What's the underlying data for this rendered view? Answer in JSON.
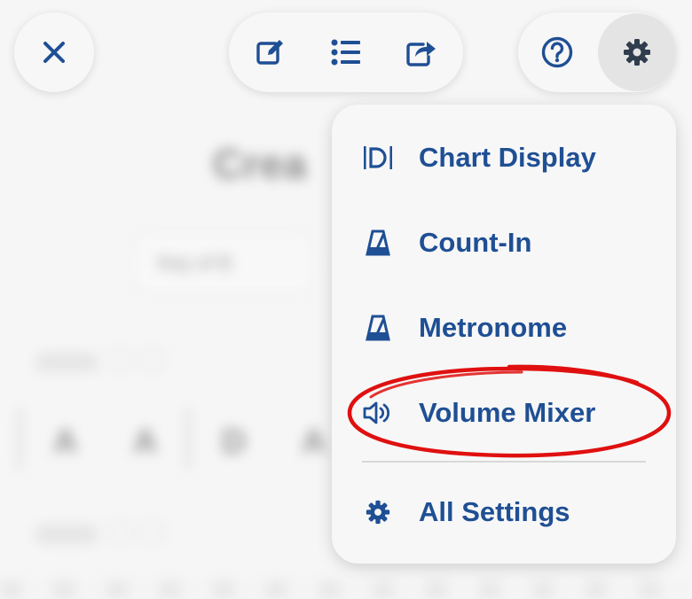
{
  "toolbar": {
    "close_icon": "close-icon",
    "edit_icon": "edit-icon",
    "list_icon": "list-icon",
    "share_icon": "share-icon",
    "help_icon": "help-icon",
    "settings_icon": "gear-icon"
  },
  "menu": {
    "items": [
      {
        "label": "Chart Display",
        "icon": "chart-display-icon"
      },
      {
        "label": "Count-In",
        "icon": "metronome-icon"
      },
      {
        "label": "Metronome",
        "icon": "metronome-icon"
      },
      {
        "label": "Volume Mixer",
        "icon": "speaker-icon"
      },
      {
        "label": "All Settings",
        "icon": "gear-icon"
      }
    ],
    "highlighted_item": "Volume Mixer"
  },
  "colors": {
    "accent": "#1f4f94",
    "highlight_ring": "#e01010",
    "menu_bg": "#f7f7f7",
    "active_button_bg": "#e4e4e4"
  }
}
